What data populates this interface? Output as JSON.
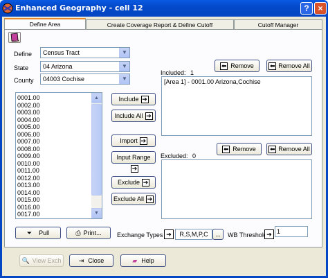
{
  "window": {
    "title": "Enhanced Geography - cell 12",
    "help_label": "?",
    "close_label": "×"
  },
  "tabs": [
    {
      "label": "Define Area",
      "active": true
    },
    {
      "label": "Create Coverage Report & Define Cutoff",
      "active": false
    },
    {
      "label": "Cutoff Manager",
      "active": false
    }
  ],
  "form": {
    "define_label": "Define",
    "define_value": "Census Tract",
    "state_label": "State",
    "state_value": "04 Arizona",
    "county_label": "County",
    "county_value": "04003 Cochise"
  },
  "tract_list": [
    "0001.00",
    "0002.00",
    "0003.00",
    "0004.00",
    "0005.00",
    "0006.00",
    "0007.00",
    "0008.00",
    "0009.00",
    "0010.00",
    "0011.00",
    "0012.00",
    "0013.00",
    "0014.00",
    "0015.00",
    "0016.00",
    "0017.00"
  ],
  "buttons": {
    "include": "Include",
    "include_all": "Include All",
    "import": "Import",
    "input_range": "Input Range",
    "exclude": "Exclude",
    "exclude_all": "Exclude All",
    "remove": "Remove",
    "remove_all": "Remove All",
    "pull": "Pull",
    "print": "Print...",
    "ellipsis": "...",
    "view_exch": "View Exch",
    "close": "Close",
    "help": "Help"
  },
  "included": {
    "label": "Included:",
    "count": "1",
    "items": [
      "[Area 1] - 0001.00 Arizona,Cochise"
    ]
  },
  "excluded": {
    "label": "Excluded:",
    "count": "0"
  },
  "exchange": {
    "label": "Exchange Types",
    "value": "R,S,M,P,C"
  },
  "threshold": {
    "label": "WB Threshold",
    "value": "1"
  },
  "colors": {
    "titlebar": "#0546c4",
    "client_bg": "#ece9d8",
    "active_tab_accent": "#e68b2c"
  }
}
